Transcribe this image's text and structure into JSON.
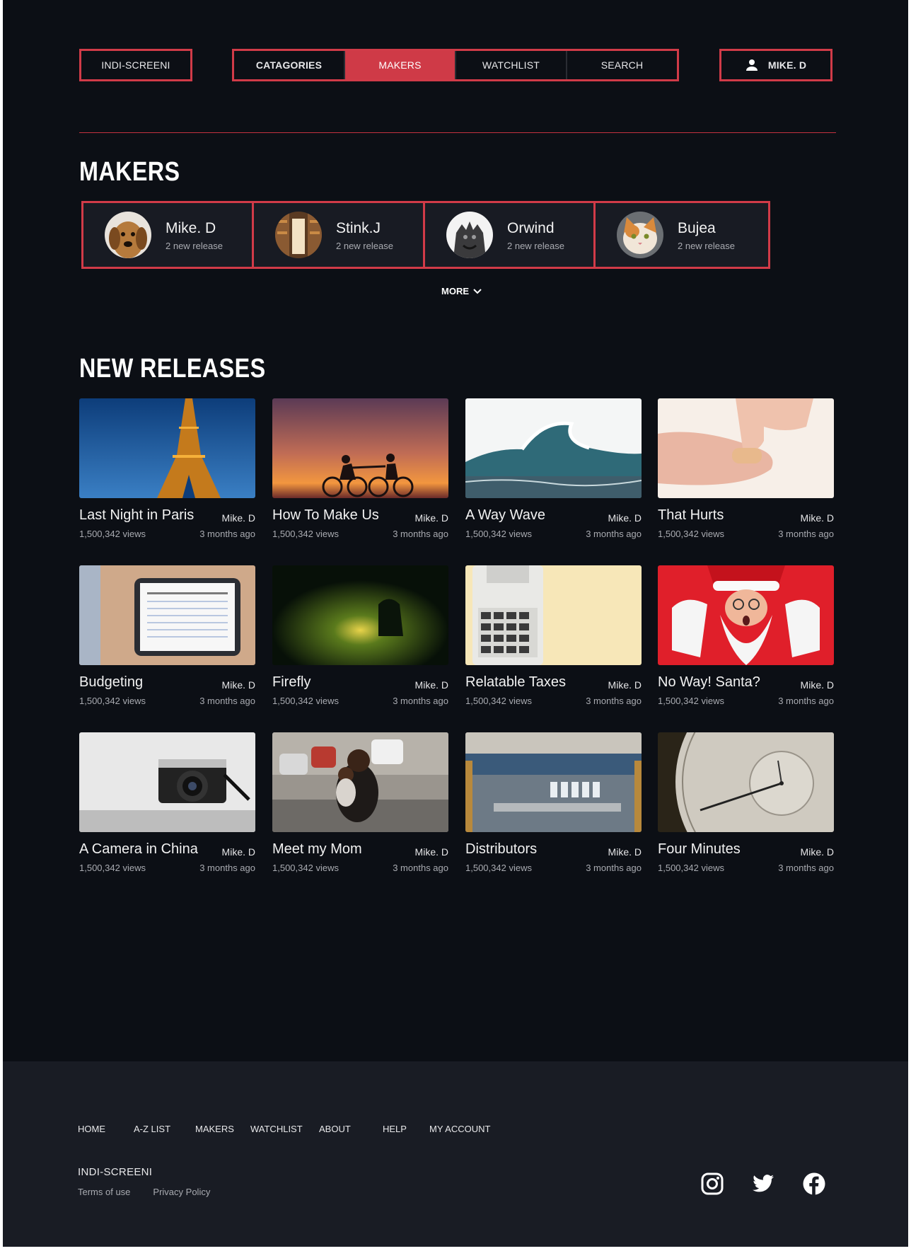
{
  "nav": {
    "brand": "INDI-SCREENI",
    "menu": [
      "CATAGORIES",
      "MAKERS",
      "WATCHLIST",
      "SEARCH"
    ],
    "active": "MAKERS",
    "user": "MIKE. D",
    "accent": "#d13b48"
  },
  "makers": {
    "title": "MAKERS",
    "items": [
      {
        "name": "Mike. D",
        "subtitle": "2 new release",
        "avatar": "dog-avatar"
      },
      {
        "name": "Stink.J",
        "subtitle": "2 new release",
        "avatar": "library-avatar"
      },
      {
        "name": "Orwind",
        "subtitle": "2 new release",
        "avatar": "gargoyle-avatar"
      },
      {
        "name": "Bujea",
        "subtitle": "2 new release",
        "avatar": "cat-avatar"
      }
    ],
    "more_label": "MORE"
  },
  "releases": {
    "title": "NEW RELEASES",
    "items": [
      {
        "title": "Last Night in Paris",
        "maker": "Mike. D",
        "views": "1,500,342 views",
        "age": "3 months ago",
        "thumb": "eiffel-tower"
      },
      {
        "title": "How To Make Us",
        "maker": "Mike. D",
        "views": "1,500,342 views",
        "age": "3 months ago",
        "thumb": "sunset-cyclists"
      },
      {
        "title": "A Way Wave",
        "maker": "Mike. D",
        "views": "1,500,342 views",
        "age": "3 months ago",
        "thumb": "ocean-wave"
      },
      {
        "title": "That Hurts",
        "maker": "Mike. D",
        "views": "1,500,342 views",
        "age": "3 months ago",
        "thumb": "bandaged-finger"
      },
      {
        "title": "Budgeting",
        "maker": "Mike. D",
        "views": "1,500,342 views",
        "age": "3 months ago",
        "thumb": "tablet-budget"
      },
      {
        "title": "Firefly",
        "maker": "Mike. D",
        "views": "1,500,342 views",
        "age": "3 months ago",
        "thumb": "forest-light"
      },
      {
        "title": "Relatable Taxes",
        "maker": "Mike. D",
        "views": "1,500,342 views",
        "age": "3 months ago",
        "thumb": "calculator"
      },
      {
        "title": "No Way! Santa?",
        "maker": "Mike. D",
        "views": "1,500,342 views",
        "age": "3 months ago",
        "thumb": "santa"
      },
      {
        "title": "A Camera in China",
        "maker": "Mike. D",
        "views": "1,500,342 views",
        "age": "3 months ago",
        "thumb": "camera"
      },
      {
        "title": "Meet my Mom",
        "maker": "Mike. D",
        "views": "1,500,342 views",
        "age": "3 months ago",
        "thumb": "mother-child"
      },
      {
        "title": "Distributors",
        "maker": "Mike. D",
        "views": "1,500,342 views",
        "age": "3 months ago",
        "thumb": "warehouse"
      },
      {
        "title": "Four Minutes",
        "maker": "Mike. D",
        "views": "1,500,342 views",
        "age": "3 months ago",
        "thumb": "stopwatch"
      }
    ]
  },
  "footer": {
    "links": [
      "HOME",
      "A-Z LIST",
      "MAKERS",
      "WATCHLIST",
      "ABOUT",
      "HELP",
      "MY ACCOUNT"
    ],
    "brand": "INDI-SCREENI",
    "legal": [
      "Terms of use",
      "Privacy Policy"
    ],
    "social": [
      "instagram-icon",
      "twitter-icon",
      "facebook-icon"
    ]
  }
}
